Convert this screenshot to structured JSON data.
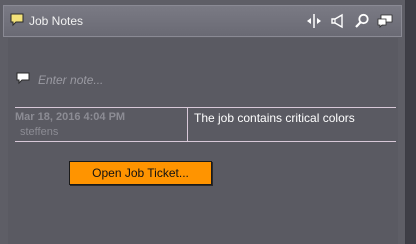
{
  "panel": {
    "title": "Job Notes",
    "toolbar_icons": [
      "split-panel-icon",
      "megaphone-icon",
      "search-icon",
      "notes-icon"
    ]
  },
  "note_entry": {
    "placeholder": "Enter note..."
  },
  "notes": [
    {
      "date": "Mar 18, 2016 4:04 PM",
      "user": "steffens",
      "text": "The job contains critical colors"
    }
  ],
  "actions": {
    "open_job_ticket_label": "Open Job Ticket..."
  },
  "colors": {
    "accent_button": "#ff9400",
    "panel_bg": "#5e5e66",
    "divider": "#d8c8d8"
  }
}
